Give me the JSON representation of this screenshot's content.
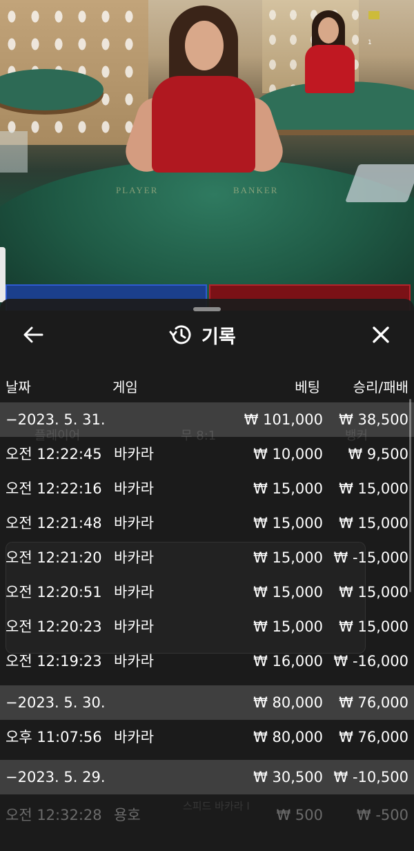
{
  "video": {
    "table_label_left": "PLAYER",
    "table_label_right": "BANKER",
    "corner_number": "1"
  },
  "history": {
    "title": "기록",
    "back_icon": "arrow-left-icon",
    "history_icon": "history-clock-icon",
    "close_icon": "close-icon",
    "columns": {
      "date": "날짜",
      "game": "게임",
      "bet": "베팅",
      "result": "승리/패배"
    },
    "rows": [
      {
        "type": "date",
        "time": "−2023. 5. 31.",
        "game": "",
        "bet": "₩ 101,000",
        "result": "₩ 38,500"
      },
      {
        "type": "entry",
        "time": "오전 12:22:45",
        "game": "바카라",
        "bet": "₩ 10,000",
        "result": "₩ 9,500"
      },
      {
        "type": "entry",
        "time": "오전 12:22:16",
        "game": "바카라",
        "bet": "₩ 15,000",
        "result": "₩ 15,000"
      },
      {
        "type": "entry",
        "time": "오전 12:21:48",
        "game": "바카라",
        "bet": "₩ 15,000",
        "result": "₩ 15,000"
      },
      {
        "type": "entry",
        "time": "오전 12:21:20",
        "game": "바카라",
        "bet": "₩ 15,000",
        "result": "₩ -15,000"
      },
      {
        "type": "entry",
        "time": "오전 12:20:51",
        "game": "바카라",
        "bet": "₩ 15,000",
        "result": "₩ 15,000"
      },
      {
        "type": "entry",
        "time": "오전 12:20:23",
        "game": "바카라",
        "bet": "₩ 15,000",
        "result": "₩ 15,000"
      },
      {
        "type": "entry",
        "time": "오전 12:19:23",
        "game": "바카라",
        "bet": "₩ 16,000",
        "result": "₩ -16,000"
      },
      {
        "type": "date",
        "time": "−2023. 5. 30.",
        "game": "",
        "bet": "₩ 80,000",
        "result": "₩ 76,000"
      },
      {
        "type": "entry",
        "time": "오후 11:07:56",
        "game": "바카라",
        "bet": "₩ 80,000",
        "result": "₩ 76,000"
      },
      {
        "type": "date",
        "time": "−2023. 5. 29.",
        "game": "",
        "bet": "₩ 30,500",
        "result": "₩ -10,500"
      },
      {
        "type": "entry",
        "faded": true,
        "time": "오전 12:32:28",
        "game": "용호",
        "bet": "₩ 500",
        "result": "₩ -500"
      }
    ]
  },
  "background_ui": {
    "player_label": "플레이어",
    "tie_label": "무 8:1",
    "banker_label": "뱅커",
    "footer_game_name": "스피드 바카라 I"
  },
  "colors": {
    "sheet_bg": "#1c1c1c",
    "date_row_bg": "#3a3a3a",
    "player_blue": "#1b3f8c",
    "banker_red": "#7b1116"
  }
}
